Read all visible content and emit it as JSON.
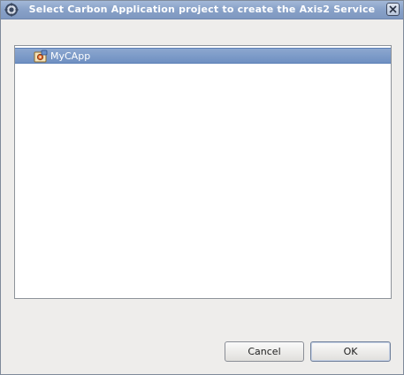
{
  "window": {
    "title": "Select Carbon Application project to create the Axis2 Service"
  },
  "list": {
    "items": [
      {
        "label": "MyCApp",
        "selected": true,
        "icon": "carbon-app-project-icon"
      }
    ]
  },
  "buttons": {
    "cancel_label": "Cancel",
    "ok_label": "OK"
  },
  "colors": {
    "titlebar": "#8aa3c9",
    "selection": "#7b9acb",
    "dialog_background": "#eeedeb"
  }
}
